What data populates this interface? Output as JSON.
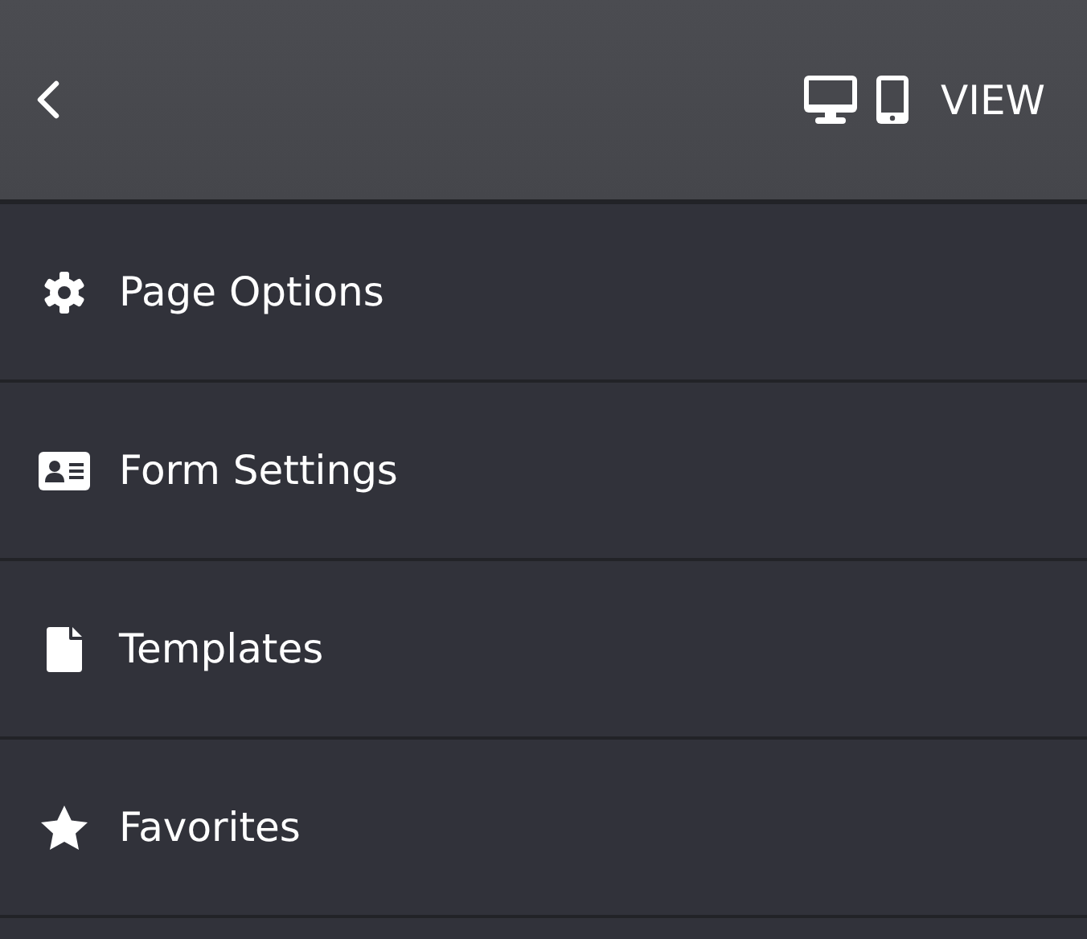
{
  "header": {
    "view_label": "VIEW"
  },
  "menu": [
    {
      "kind": "gear",
      "label": "Page Options"
    },
    {
      "kind": "id-card",
      "label": "Form Settings"
    },
    {
      "kind": "file",
      "label": "Templates"
    },
    {
      "kind": "star",
      "label": "Favorites"
    }
  ]
}
